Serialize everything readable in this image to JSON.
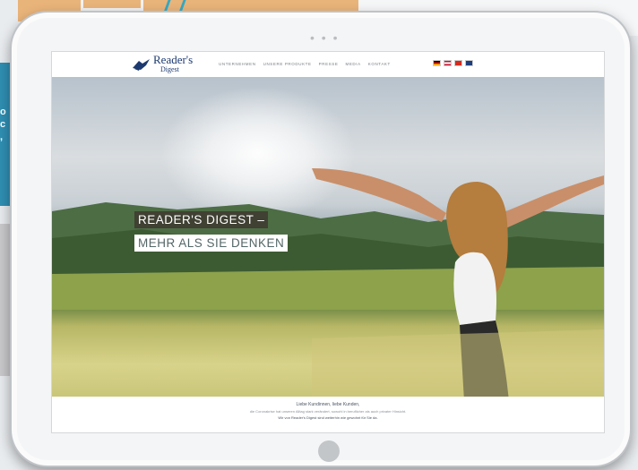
{
  "browser": {
    "dots": "• • •"
  },
  "logo": {
    "line1": "Reader's",
    "line2": "Digest"
  },
  "nav": [
    {
      "label": "UNTERNEHMEN"
    },
    {
      "label": "UNSERE PRODUKTE"
    },
    {
      "label": "PRESSE"
    },
    {
      "label": "MEDIA"
    },
    {
      "label": "KONTAKT"
    }
  ],
  "languages": [
    {
      "icon": "flag-de-icon",
      "color": "#2b2b2b"
    },
    {
      "icon": "flag-at-icon",
      "color": "#c8102e"
    },
    {
      "icon": "flag-ch-icon",
      "color": "#d52b1e"
    },
    {
      "icon": "flag-gb-icon",
      "color": "#1f3d7a"
    }
  ],
  "hero": {
    "headline_line1": "READER'S DIGEST –",
    "headline_line2": "MEHR ALS SIE DENKEN"
  },
  "footer": {
    "line1": "Liebe Kundinnen, liebe Kunden,",
    "line2": "die Coronakrise hat unseren Alltag stark verändert, sowohl in beruflicher als auch privater Hinsicht.",
    "line3": "Wir von Reader's Digest sind weiterhin wie gewohnt für Sie da."
  },
  "background": {
    "left_text": "o\nc\n,"
  },
  "colors": {
    "brand": "#1d3a70",
    "tablet_frame": "#f4f5f6"
  }
}
